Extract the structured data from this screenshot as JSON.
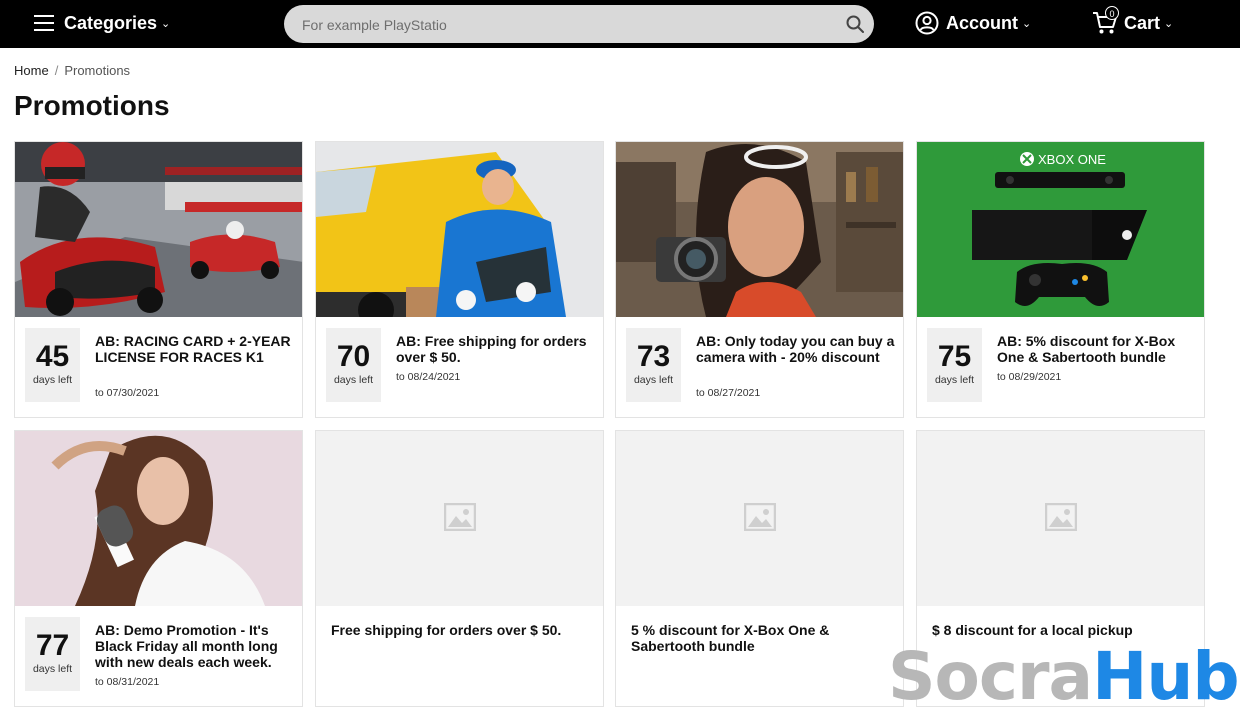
{
  "header": {
    "categories_label": "Categories",
    "search_placeholder": "For example PlayStatio",
    "account_label": "Account",
    "cart_label": "Cart",
    "cart_count": "0"
  },
  "breadcrumb": {
    "home": "Home",
    "separator": "/",
    "current": "Promotions"
  },
  "page_title": "Promotions",
  "days_left_label": "days left",
  "promotions": [
    {
      "days": "45",
      "title": "AB: RACING CARD + 2-YEAR LICENSE FOR RACES K1",
      "date": "to 07/30/2021",
      "image": "go-kart-racing"
    },
    {
      "days": "70",
      "title": "AB: Free shipping for orders over $ 50.",
      "date": "to 08/24/2021",
      "image": "delivery-man-van"
    },
    {
      "days": "73",
      "title": "AB: Only today you can buy a camera with - 20% discount",
      "date": "to 08/27/2021",
      "image": "woman-with-camera"
    },
    {
      "days": "75",
      "title": "AB: 5% discount for X-Box One & Sabertooth bundle",
      "date": "to 08/29/2021",
      "image": "xbox-one-console",
      "image_text": "XBOX ONE"
    },
    {
      "days": "77",
      "title": "AB: Demo Promotion - It's Black Friday all month long with new deals each week.",
      "date": "to 08/31/2021",
      "image": "woman-hair-brush"
    },
    {
      "title": "Free shipping for orders over $ 50.",
      "image": "placeholder"
    },
    {
      "title": "5 % discount for X-Box One & Sabertooth bundle",
      "image": "placeholder"
    },
    {
      "title": "$ 8 discount for a local pickup",
      "image": "placeholder"
    }
  ],
  "watermark": {
    "part1": "Socra",
    "part2": "Hub"
  },
  "colors": {
    "header_bg": "#000000",
    "xbox_green": "#2f9a3a",
    "watermark_blue": "#1e88e5"
  }
}
